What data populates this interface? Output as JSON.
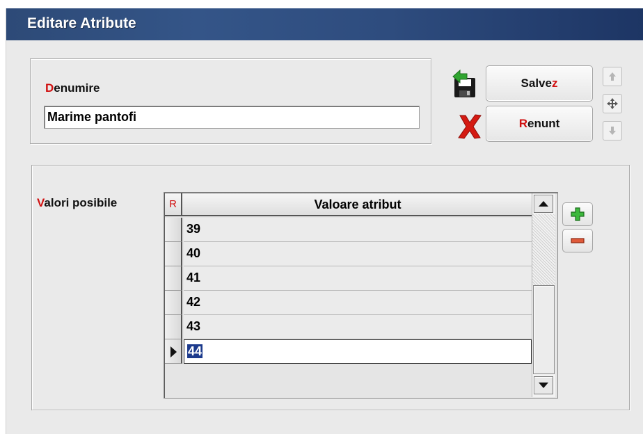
{
  "window": {
    "title": "Editare Atribute"
  },
  "form": {
    "denumire_label_mnemonic": "D",
    "denumire_label_rest": "enumire",
    "denumire_value": "Marime pantofi",
    "valori_label_mnemonic": "V",
    "valori_label_rest": "alori posibile"
  },
  "buttons": {
    "save_pre": "Salve",
    "save_mnemonic": "z",
    "cancel_mnemonic": "R",
    "cancel_rest": "enunt"
  },
  "grid": {
    "r_header": "R",
    "column_header": "Valoare atribut",
    "rows": [
      "39",
      "40",
      "41",
      "42",
      "43",
      "44"
    ],
    "active_row": "44"
  },
  "icons": {
    "save": "save-disk-icon",
    "cancel": "red-x-icon",
    "up": "arrow-up-icon",
    "move": "move-arrows-icon",
    "down": "arrow-down-icon",
    "add": "green-plus-icon",
    "remove": "red-minus-icon"
  },
  "colors": {
    "mnemonic": "#d01010",
    "title_bar": "#2e4c7e",
    "selection": "#1c3a8c"
  }
}
